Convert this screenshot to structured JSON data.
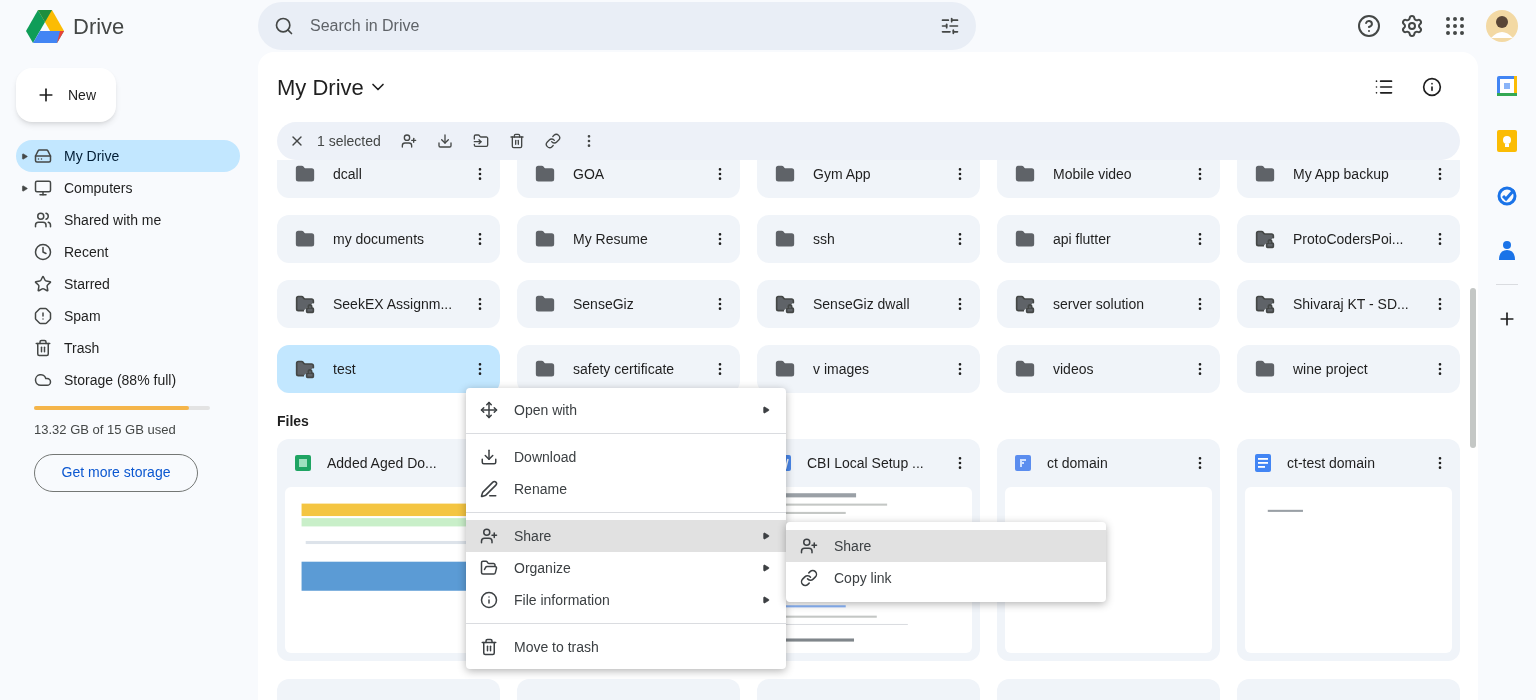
{
  "app": {
    "name": "Drive"
  },
  "search": {
    "placeholder": "Search in Drive"
  },
  "sidebar": {
    "new_button": "New",
    "items": [
      {
        "label": "My Drive",
        "selected": true,
        "expandable": true
      },
      {
        "label": "Computers",
        "selected": false,
        "expandable": true
      },
      {
        "label": "Shared with me",
        "selected": false,
        "expandable": false
      },
      {
        "label": "Recent",
        "selected": false,
        "expandable": false
      },
      {
        "label": "Starred",
        "selected": false,
        "expandable": false
      },
      {
        "label": "Spam",
        "selected": false,
        "expandable": false
      },
      {
        "label": "Trash",
        "selected": false,
        "expandable": false
      },
      {
        "label": "Storage (88% full)",
        "selected": false,
        "expandable": false
      }
    ],
    "storage": {
      "level": 0.88,
      "text": "13.32 GB of 15 GB used",
      "button": "Get more storage"
    }
  },
  "main": {
    "title": "My Drive",
    "selection_bar": {
      "count": "1 selected"
    },
    "folders": [
      {
        "name": "dcall",
        "shared": false,
        "selected": false
      },
      {
        "name": "GOA",
        "shared": false,
        "selected": false
      },
      {
        "name": "Gym App",
        "shared": false,
        "selected": false
      },
      {
        "name": "Mobile video",
        "shared": false,
        "selected": false
      },
      {
        "name": "My App backup",
        "shared": false,
        "selected": false
      },
      {
        "name": "my documents",
        "shared": false,
        "selected": false
      },
      {
        "name": "My Resume",
        "shared": false,
        "selected": false
      },
      {
        "name": "ssh",
        "shared": false,
        "selected": false
      },
      {
        "name": "api flutter",
        "shared": false,
        "selected": false
      },
      {
        "name": "ProtoCodersPoi...",
        "shared": true,
        "selected": false
      },
      {
        "name": "SeekEX Assignm...",
        "shared": true,
        "selected": false
      },
      {
        "name": "SenseGiz",
        "shared": false,
        "selected": false
      },
      {
        "name": "SenseGiz dwall",
        "shared": true,
        "selected": false
      },
      {
        "name": "server solution",
        "shared": true,
        "selected": false
      },
      {
        "name": "Shivaraj KT - SD...",
        "shared": true,
        "selected": false
      },
      {
        "name": "test",
        "shared": true,
        "selected": true
      },
      {
        "name": "safety certificate",
        "shared": false,
        "selected": false
      },
      {
        "name": "v images",
        "shared": false,
        "selected": false
      },
      {
        "name": "videos",
        "shared": false,
        "selected": false
      },
      {
        "name": "wine project",
        "shared": false,
        "selected": false
      }
    ],
    "files_heading": "Files",
    "files": [
      {
        "name": "Added Aged Do...",
        "kind": "sheet"
      },
      {
        "name": "CBI Local Setup ...",
        "kind": "word"
      },
      {
        "name": "ct domain",
        "kind": "form"
      },
      {
        "name": "ct-test domain",
        "kind": "doc"
      }
    ]
  },
  "context_menu": {
    "items": [
      {
        "kind": "item",
        "label": "Open with",
        "submenu": true,
        "selected": false
      },
      {
        "kind": "divider"
      },
      {
        "kind": "item",
        "label": "Download",
        "submenu": false,
        "selected": false
      },
      {
        "kind": "item",
        "label": "Rename",
        "submenu": false,
        "selected": false
      },
      {
        "kind": "divider"
      },
      {
        "kind": "item",
        "label": "Share",
        "submenu": true,
        "selected": true
      },
      {
        "kind": "item",
        "label": "Organize",
        "submenu": true,
        "selected": false
      },
      {
        "kind": "item",
        "label": "File information",
        "submenu": true,
        "selected": false
      },
      {
        "kind": "divider"
      },
      {
        "kind": "item",
        "label": "Move to trash",
        "submenu": false,
        "selected": false
      }
    ],
    "submenu": [
      {
        "label": "Share",
        "selected": true
      },
      {
        "label": "Copy link",
        "selected": false
      }
    ]
  }
}
